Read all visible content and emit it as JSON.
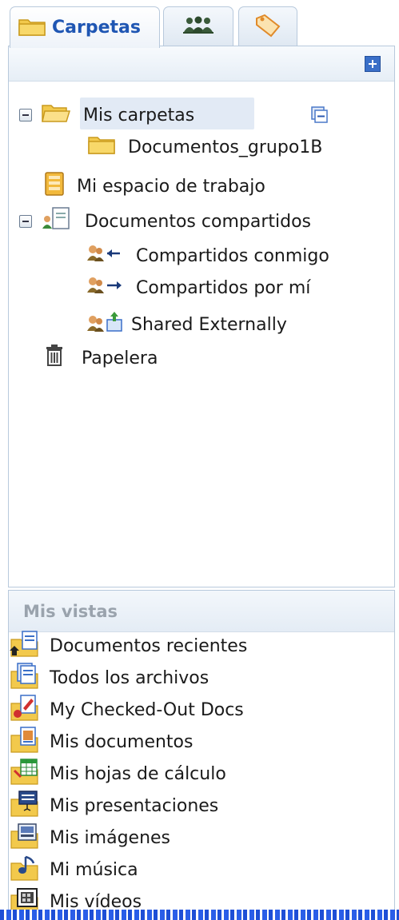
{
  "tabs": [
    {
      "label": "Carpetas",
      "icon": "folder-icon",
      "active": true
    },
    {
      "label": "",
      "icon": "users-icon",
      "active": false
    },
    {
      "label": "",
      "icon": "tag-icon",
      "active": false
    }
  ],
  "tree": {
    "mis_carpetas": "Mis carpetas",
    "documentos_grupo": "Documentos_grupo1B",
    "mi_espacio": "Mi espacio de trabajo",
    "documentos_compartidos": "Documentos compartidos",
    "compartidos_conmigo": "Compartidos conmigo",
    "compartidos_por_mi": "Compartidos por mí",
    "shared_externally": "Shared Externally",
    "papelera": "Papelera"
  },
  "views": {
    "header": "Mis vistas",
    "items": [
      {
        "label": "Documentos recientes",
        "icon": "recent-docs-icon"
      },
      {
        "label": "Todos los archivos",
        "icon": "all-files-icon"
      },
      {
        "label": "My Checked-Out Docs",
        "icon": "checked-out-icon"
      },
      {
        "label": "Mis documentos",
        "icon": "my-documents-icon"
      },
      {
        "label": "Mis hojas de cálculo",
        "icon": "spreadsheet-icon"
      },
      {
        "label": "Mis presentaciones",
        "icon": "presentation-icon"
      },
      {
        "label": "Mis imágenes",
        "icon": "image-icon"
      },
      {
        "label": "Mi música",
        "icon": "music-icon"
      },
      {
        "label": "Mis vídeos",
        "icon": "video-icon"
      }
    ]
  },
  "colors": {
    "accent": "#1f56b3",
    "selected": "#e2eaf5",
    "border": "#b8c9dc"
  }
}
